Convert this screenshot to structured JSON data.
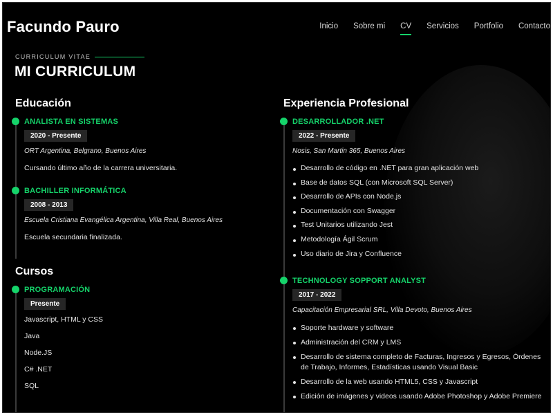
{
  "brand": "Facundo Pauro",
  "nav": [
    "Inicio",
    "Sobre mi",
    "CV",
    "Servicios",
    "Portfolio",
    "Contacto"
  ],
  "active_nav": "CV",
  "subtitle": "CURRICULUM VITAE",
  "page_title": "MI CURRICULUM",
  "education": {
    "title": "Educación",
    "items": [
      {
        "title": "ANALISTA EN SISTEMAS",
        "dates": "2020 - Presente",
        "place": "ORT Argentina, Belgrano, Buenos Aires",
        "desc": "Cursando último año de la carrera universitaria."
      },
      {
        "title": "BACHILLER INFORMÁTICA",
        "dates": "2008 - 2013",
        "place": "Escuela Cristiana Evangélica Argentina, Villa Real, Buenos Aires",
        "desc": "Escuela secundaria finalizada."
      }
    ]
  },
  "courses": {
    "title": "Cursos",
    "items": [
      {
        "title": "PROGRAMACIÓN",
        "dates": "Presente",
        "list": [
          "Javascript, HTML y CSS",
          "Java",
          "Node.JS",
          "C# .NET",
          "SQL"
        ]
      }
    ]
  },
  "experience": {
    "title": "Experiencia Profesional",
    "items": [
      {
        "title": "DESARROLLADOR .NET",
        "dates": "2022 - Presente",
        "place": "Nosis, San Martin 365, Buenos Aires",
        "bullets": [
          "Desarrollo de código en .NET para gran aplicación web",
          "Base de datos SQL (con Microsoft SQL Server)",
          "Desarrollo de APIs con Node.js",
          "Documentación con Swagger",
          "Test Unitarios utilizando Jest",
          "Metodología Ágil Scrum",
          "Uso diario de Jira y Confluence"
        ]
      },
      {
        "title": "TECHNOLOGY SOPPORT ANALYST",
        "dates": "2017 - 2022",
        "place": "Capacitación Empresarial SRL, Villa Devoto, Buenos Aires",
        "bullets": [
          "Soporte hardware y software",
          "Administración del CRM y LMS",
          "Desarrollo de sistema completo de Facturas, Ingresos y Egresos, Órdenes de Trabajo, Informes, Estadísticas usando Visual Basic",
          "Desarrollo de la web usando HTML5, CSS y Javascript",
          "Edición de imágenes y videos usando Adobe Photoshop y Adobe Premiere"
        ]
      }
    ]
  },
  "colors": {
    "accent": "#15d36a",
    "background": "#000000",
    "badge": "#262626"
  }
}
